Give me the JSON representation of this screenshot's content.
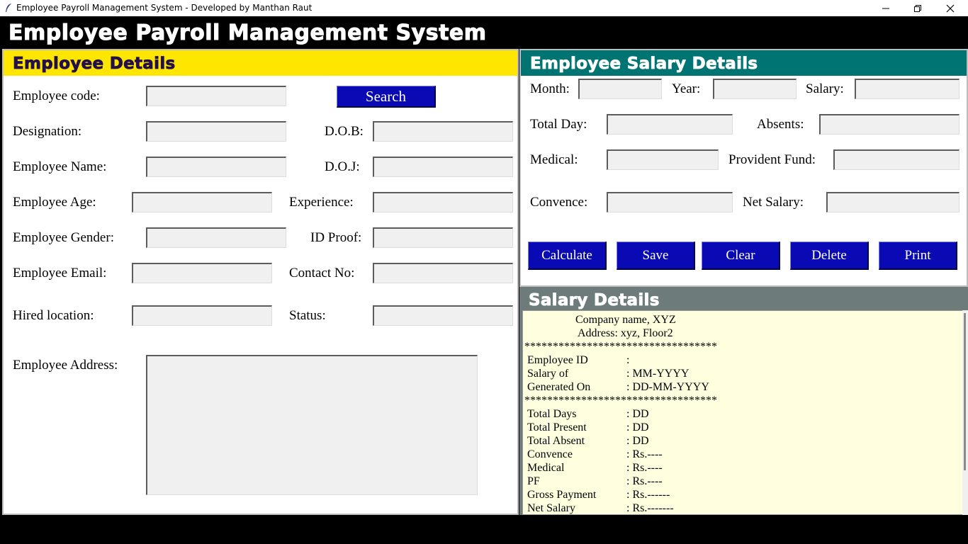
{
  "window": {
    "title": "Employee Payroll Management System - Developed by Manthan Raut",
    "icons": [
      "feather-icon",
      "minimize-icon",
      "restore-icon",
      "close-icon"
    ]
  },
  "header": {
    "title": "Employee Payroll Management System"
  },
  "employee": {
    "heading": "Employee Details",
    "heading_bg": "#ffe600",
    "heading_color": "#23104a",
    "labels": {
      "code": "Employee code:",
      "designation": "Designation:",
      "dob": "D.O.B:",
      "name": "Employee Name:",
      "doj": "D.O.J:",
      "age": "Employee Age:",
      "experience": "Experience:",
      "gender": "Employee Gender:",
      "id_proof": "ID Proof:",
      "email": "Employee Email:",
      "contact": "Contact No:",
      "hired_location": "Hired location:",
      "status": "Status:",
      "address": "Employee Address:"
    },
    "search_label": "Search"
  },
  "salary": {
    "heading": "Employee Salary Details",
    "heading_bg": "#007373",
    "labels": {
      "month": "Month:",
      "year": "Year:",
      "salary": "Salary:",
      "total_day": "Total Day:",
      "absents": "Absents:",
      "medical": "Medical:",
      "pf": "Provident Fund:",
      "convence": "Convence:",
      "net_salary": "Net Salary:"
    },
    "buttons": {
      "calculate": "Calculate",
      "save": "Save",
      "clear": "Clear",
      "delete": "Delete",
      "print": "Print"
    },
    "button_color": "#0a0ab4"
  },
  "slip": {
    "heading": "Salary Details",
    "heading_bg": "#6e7b7b",
    "company": "Company name, XYZ",
    "address": "Address: xyz, Floor2",
    "stars": "**********************************",
    "employee_id": {
      "label": "Employee ID",
      "value": ":"
    },
    "salary_of": {
      "label": "Salary of",
      "value": ":  MM-YYYY"
    },
    "generated_on": {
      "label": "Generated On",
      "value": ":  DD-MM-YYYY"
    },
    "total_days": {
      "label": "Total Days",
      "value": ": DD"
    },
    "total_present": {
      "label": "Total Present",
      "value": ": DD"
    },
    "total_absent": {
      "label": "Total Absent",
      "value": ": DD"
    },
    "convence": {
      "label": "Convence",
      "value": ": Rs.----"
    },
    "medical": {
      "label": "Medical",
      "value": ": Rs.----"
    },
    "pf": {
      "label": "PF",
      "value": ": Rs.----"
    },
    "gross": {
      "label": "Gross Payment",
      "value": ": Rs.------"
    },
    "net": {
      "label": "Net Salary",
      "value": ": Rs.-------"
    }
  }
}
